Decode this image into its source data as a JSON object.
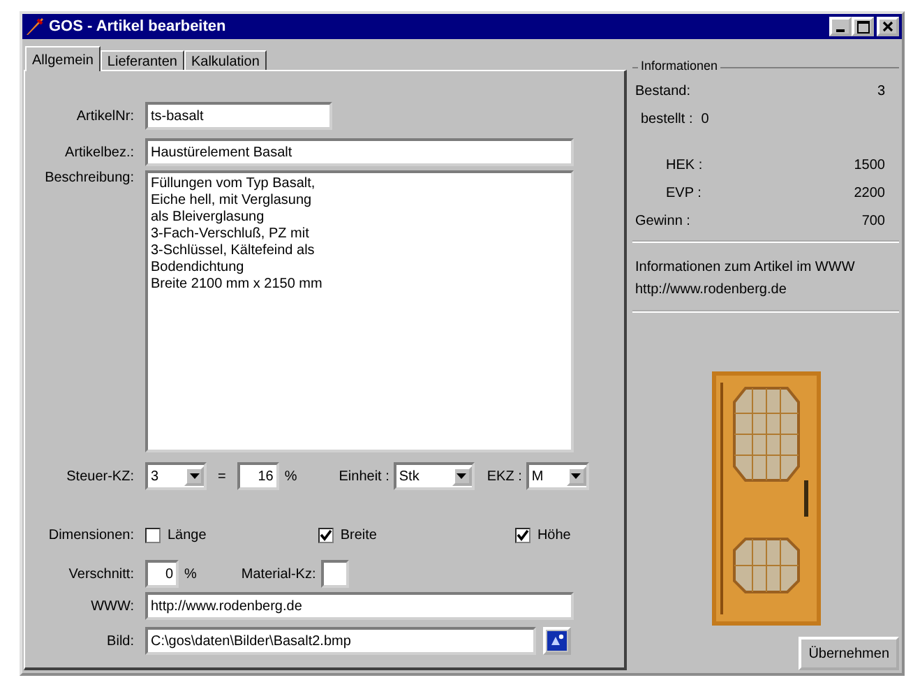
{
  "window": {
    "title": "GOS - Artikel bearbeiten"
  },
  "tabs": [
    {
      "label": "Allgemein",
      "selected": true
    },
    {
      "label": "Lieferanten",
      "selected": false
    },
    {
      "label": "Kalkulation",
      "selected": false
    }
  ],
  "form": {
    "artikel_nr": {
      "label": "ArtikelNr:",
      "value": "ts-basalt"
    },
    "artikel_bez": {
      "label": "Artikelbez.:",
      "value": "Haustürelement Basalt"
    },
    "beschreibung": {
      "label": "Beschreibung:",
      "lines": [
        "Füllungen vom Typ Basalt,",
        "Eiche hell, mit Verglasung",
        "als Bleiverglasung",
        "3-Fach-Verschluß, PZ mit",
        "3-Schlüssel, Kältefeind als",
        "Bodendichtung",
        "Breite 2100 mm x 2150 mm"
      ]
    },
    "steuer": {
      "label": "Steuer-KZ:",
      "value": "3",
      "equals": "=",
      "rate": "16",
      "percent": "%"
    },
    "einheit": {
      "label": "Einheit :",
      "value": "Stk"
    },
    "ekz": {
      "label": "EKZ :",
      "value": "M"
    },
    "dimensionen": {
      "label": "Dimensionen:",
      "options": [
        {
          "label": "Länge",
          "checked": false
        },
        {
          "label": "Breite",
          "checked": true
        },
        {
          "label": "Höhe",
          "checked": true
        }
      ]
    },
    "verschnitt": {
      "label": "Verschnitt:",
      "value": "0",
      "unit": "%"
    },
    "material_kz": {
      "label": "Material-Kz:"
    },
    "www": {
      "label": "WWW:",
      "value": "http://www.rodenberg.de"
    },
    "bild": {
      "label": "Bild:",
      "value": "C:\\gos\\daten\\Bilder\\Basalt2.bmp"
    }
  },
  "info": {
    "title": "Informationen",
    "rows": [
      {
        "kind": "split",
        "label": "Bestand:",
        "value": "3"
      },
      {
        "kind": "inline",
        "label": "bestellt :",
        "value": "0"
      },
      {
        "kind": "indented",
        "label": "HEK :",
        "value": "1500"
      },
      {
        "kind": "indented",
        "label": "EVP :",
        "value": "2200"
      },
      {
        "kind": "split",
        "label": "Gewinn :",
        "value": "700"
      }
    ],
    "link_text": "Informationen zum Artikel im WWW",
    "link_url": "http://www.rodenberg.de"
  },
  "apply_button": "Übernehmen"
}
